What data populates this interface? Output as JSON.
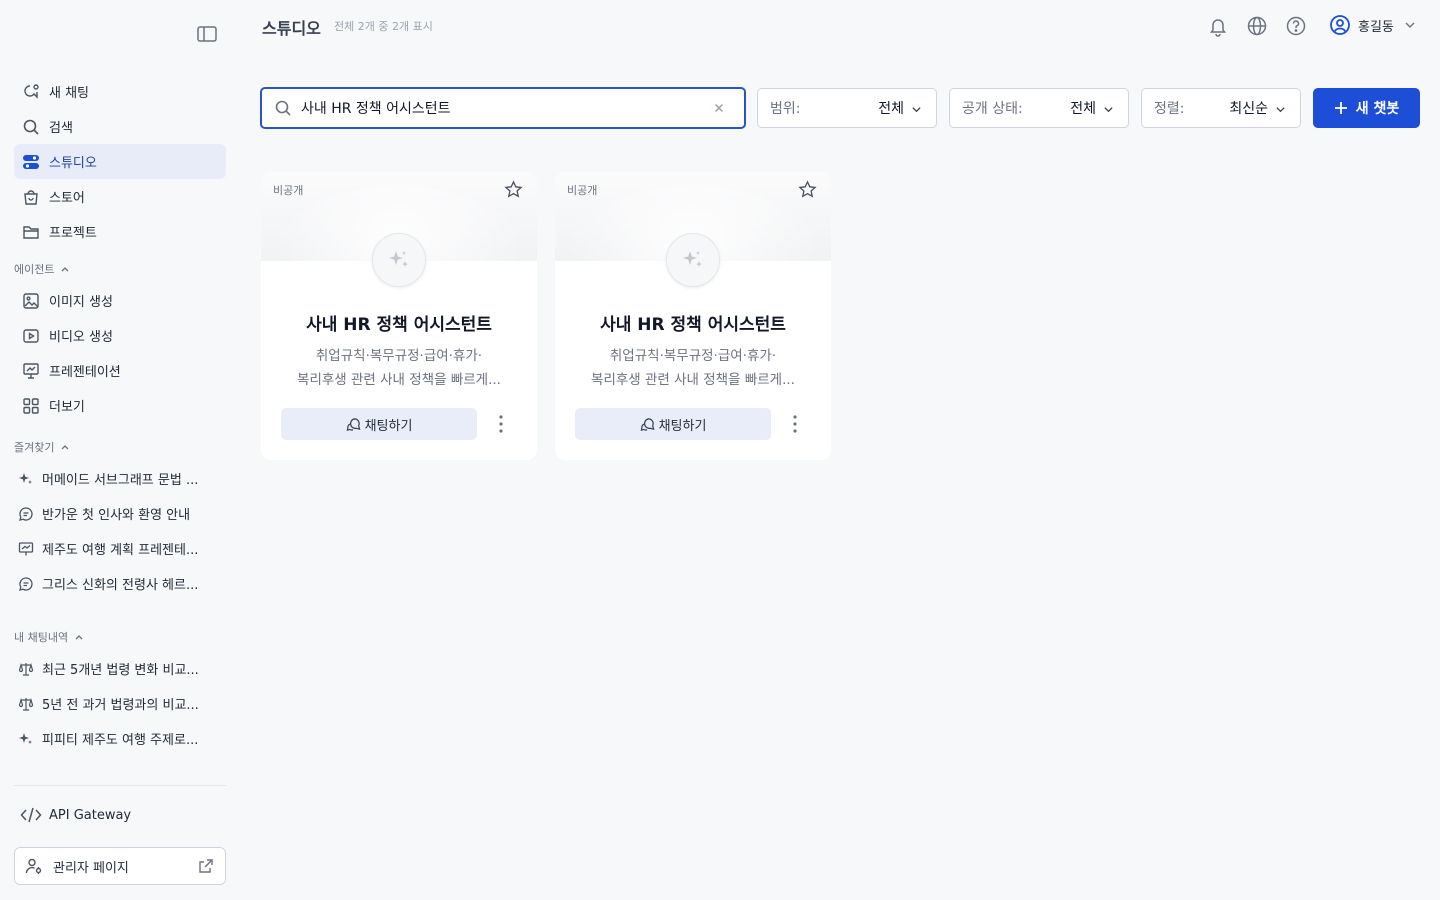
{
  "header": {
    "title": "스튜디오",
    "count_text": "전체 2개 중 2개 표시",
    "user_name": "홍길동"
  },
  "sidebar": {
    "main_items": [
      {
        "label": "새 채팅",
        "icon": "new-chat-icon"
      },
      {
        "label": "검색",
        "icon": "search-icon"
      },
      {
        "label": "스튜디오",
        "icon": "studio-icon",
        "active": true
      },
      {
        "label": "스토어",
        "icon": "store-bag-icon"
      },
      {
        "label": "프로젝트",
        "icon": "folder-icon"
      }
    ],
    "agents_heading": "에이전트",
    "agents": [
      {
        "label": "이미지 생성",
        "icon": "image-icon"
      },
      {
        "label": "비디오 생성",
        "icon": "video-icon"
      },
      {
        "label": "프레젠테이션",
        "icon": "presentation-icon"
      },
      {
        "label": "더보기",
        "icon": "grid-icon"
      }
    ],
    "favorites_heading": "즐겨찾기",
    "favorites": [
      {
        "label": "머메이드 서브그래프 문법 ...",
        "icon": "sparkle-icon"
      },
      {
        "label": "반가운 첫 인사와 환영 안내",
        "icon": "chat-bubble-icon"
      },
      {
        "label": "제주도 여행 계획 프레젠테...",
        "icon": "presentation-icon"
      },
      {
        "label": "그리스 신화의 전령사 헤르...",
        "icon": "chat-bubble-icon"
      }
    ],
    "history_heading": "내 채팅내역",
    "history": [
      {
        "label": "최근 5개년 법령 변화 비교...",
        "icon": "scale-icon"
      },
      {
        "label": "5년 전 과거 법령과의 비교...",
        "icon": "scale-icon"
      },
      {
        "label": "피피티 제주도 여행 주제로...",
        "icon": "sparkle-icon"
      }
    ],
    "api_label": "API Gateway",
    "admin_label": "관리자 페이지"
  },
  "toolbar": {
    "search_value": "사내 HR 정책 어시스턴트",
    "scope_label": "범위:",
    "scope_value": "전체",
    "visibility_label": "공개 상태:",
    "visibility_value": "전체",
    "sort_label": "정렬:",
    "sort_value": "최신순",
    "new_bot_label": "새 챗봇"
  },
  "cards": [
    {
      "visibility": "비공개",
      "name": "사내 HR 정책 어시스턴트",
      "desc_line1": "취업규칙·복무규정·급여·휴가·",
      "desc_line2": "복리후생 관련 사내 정책을 빠르게...",
      "chat_label": "채팅하기"
    },
    {
      "visibility": "비공개",
      "name": "사내 HR 정책 어시스턴트",
      "desc_line1": "취업규칙·복무규정·급여·휴가·",
      "desc_line2": "복리후생 관련 사내 정책을 빠르게...",
      "chat_label": "채팅하기"
    }
  ],
  "colors": {
    "accent": "#1d4ed8",
    "active_bg": "#e7ecf8",
    "chat_button_bg": "#e8edf9"
  }
}
